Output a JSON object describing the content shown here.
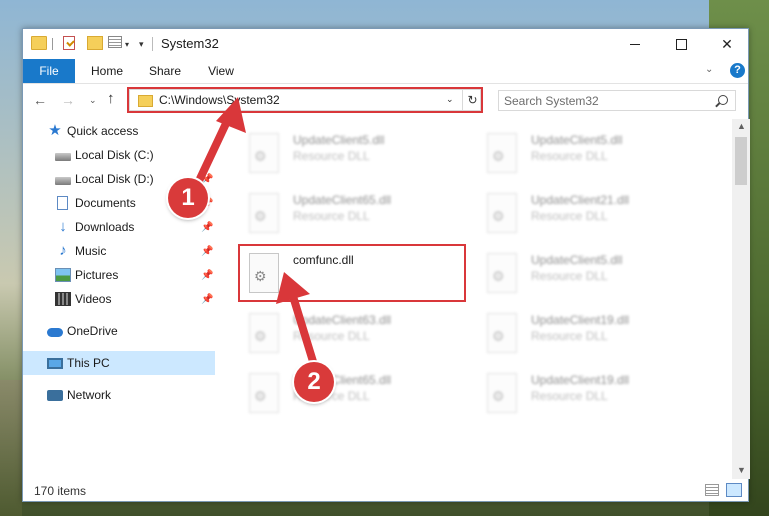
{
  "window": {
    "title": "System32"
  },
  "ribbon": {
    "tabs": [
      "File",
      "Home",
      "Share",
      "View"
    ]
  },
  "address": {
    "path": "C:\\Windows\\System32",
    "search_placeholder": "Search System32"
  },
  "sidebar": {
    "items": [
      {
        "label": "Quick access",
        "icon": "star-icon",
        "pinned": false
      },
      {
        "label": "Local Disk (C:)",
        "icon": "disk-icon",
        "pinned": false
      },
      {
        "label": "Local Disk (D:)",
        "icon": "disk-icon",
        "pinned": true
      },
      {
        "label": "Documents",
        "icon": "documents-icon",
        "pinned": true
      },
      {
        "label": "Downloads",
        "icon": "download-icon",
        "pinned": true
      },
      {
        "label": "Music",
        "icon": "music-icon",
        "pinned": true
      },
      {
        "label": "Pictures",
        "icon": "pictures-icon",
        "pinned": true
      },
      {
        "label": "Videos",
        "icon": "videos-icon",
        "pinned": true
      },
      {
        "label": "OneDrive",
        "icon": "onedrive-icon",
        "pinned": false
      },
      {
        "label": "This PC",
        "icon": "pc-icon",
        "pinned": false,
        "selected": true
      },
      {
        "label": "Network",
        "icon": "network-icon",
        "pinned": false
      }
    ]
  },
  "files": [
    {
      "name": "UpdateClient5.dll",
      "type": "Resource DLL",
      "blurred": true
    },
    {
      "name": "UpdateClient5.dll",
      "type": "Resource DLL",
      "blurred": true
    },
    {
      "name": "UpdateClient65.dll",
      "type": "Resource DLL",
      "blurred": true
    },
    {
      "name": "UpdateClient21.dll",
      "type": "Resource DLL",
      "blurred": true
    },
    {
      "name": "comfunc.dll",
      "type": "",
      "blurred": false,
      "highlighted": true
    },
    {
      "name": "UpdateClient5.dll",
      "type": "Resource DLL",
      "blurred": true
    },
    {
      "name": "UpdateClient63.dll",
      "type": "Resource DLL",
      "blurred": true
    },
    {
      "name": "UpdateClient19.dll",
      "type": "Resource DLL",
      "blurred": true
    },
    {
      "name": "UpdateClient65.dll",
      "type": "Resource DLL",
      "blurred": true
    },
    {
      "name": "UpdateClient19.dll",
      "type": "Resource DLL",
      "blurred": true
    }
  ],
  "status": {
    "item_count": "170 items"
  },
  "annotations": {
    "step1": "1",
    "step2": "2",
    "highlight_color": "#d9373a"
  },
  "colors": {
    "accent": "#1979ca",
    "selection": "#cce8ff"
  }
}
